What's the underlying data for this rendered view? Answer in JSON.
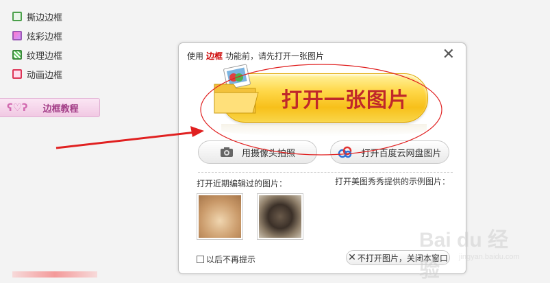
{
  "sidebar": {
    "items": [
      {
        "label": "撕边边框",
        "icon": "torn-frame-icon"
      },
      {
        "label": "炫彩边框",
        "icon": "colorful-frame-icon"
      },
      {
        "label": "纹理边框",
        "icon": "texture-frame-icon"
      },
      {
        "label": "动画边框",
        "icon": "animation-frame-icon"
      }
    ],
    "tutorial_label": "边框教程"
  },
  "dialog": {
    "title_prefix": "使用",
    "title_highlight": "边框",
    "title_suffix": "功能前，请先打开一张图片",
    "close_symbol": "✕",
    "open_button_label": "打开一张图片",
    "camera_button_label": "用摄像头拍照",
    "cloud_button_label": "打开百度云网盘图片",
    "recent_label": "打开近期编辑过的图片：",
    "sample_label": "打开美图秀秀提供的示例图片：",
    "dont_show_label": "以后不再提示",
    "no_open_label": "不打开图片，关闭本窗口",
    "no_open_symbol": "✕"
  },
  "watermark": {
    "main": "Bai du 经验",
    "sub": "jingyan.baidu.com"
  },
  "colors": {
    "accent_red": "#c0282a",
    "button_yellow": "#f7c01a",
    "annotation_red": "#e02020"
  }
}
